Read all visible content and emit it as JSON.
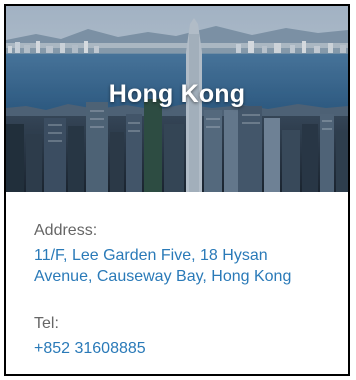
{
  "location": {
    "city": "Hong Kong",
    "address_label": "Address:",
    "address_line1": "11/F, Lee Garden Five, 18 Hysan",
    "address_line2": "Avenue, Causeway Bay, Hong Kong",
    "tel_label": "Tel:",
    "tel_value": "+852 31608885"
  },
  "colors": {
    "link": "#2a7ab8",
    "label": "#666666",
    "border": "#000000"
  }
}
